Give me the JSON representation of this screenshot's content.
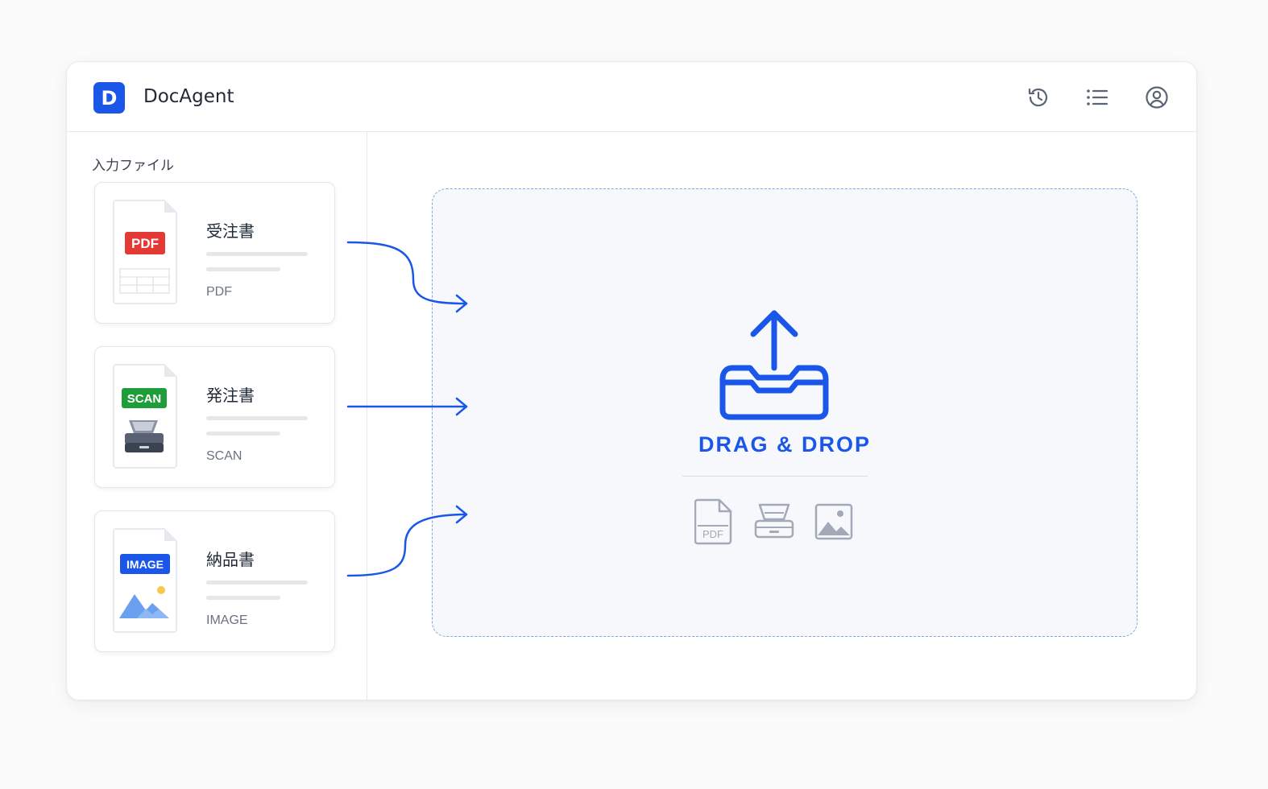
{
  "app": {
    "logo_letter": "D",
    "title": "DocAgent"
  },
  "header_icons": [
    "history-icon",
    "list-icon",
    "user-account-icon"
  ],
  "sidebar": {
    "title": "入力ファイル",
    "files": [
      {
        "name": "受注書",
        "type": "PDF",
        "badge": "PDF",
        "badge_color": "#e53935"
      },
      {
        "name": "発注書",
        "type": "SCAN",
        "badge": "SCAN",
        "badge_color": "#1e9e3a"
      },
      {
        "name": "納品書",
        "type": "IMAGE",
        "badge": "IMAGE",
        "badge_color": "#1a56e8"
      }
    ]
  },
  "dropzone": {
    "label": "DRAG & DROP",
    "format_icons": [
      "pdf-file-icon",
      "scanner-icon",
      "image-icon"
    ],
    "pdf_icon_text": "PDF"
  },
  "colors": {
    "accent": "#1a56e8",
    "border": "#e6e8ec",
    "muted_icon": "#9aa3b2"
  }
}
